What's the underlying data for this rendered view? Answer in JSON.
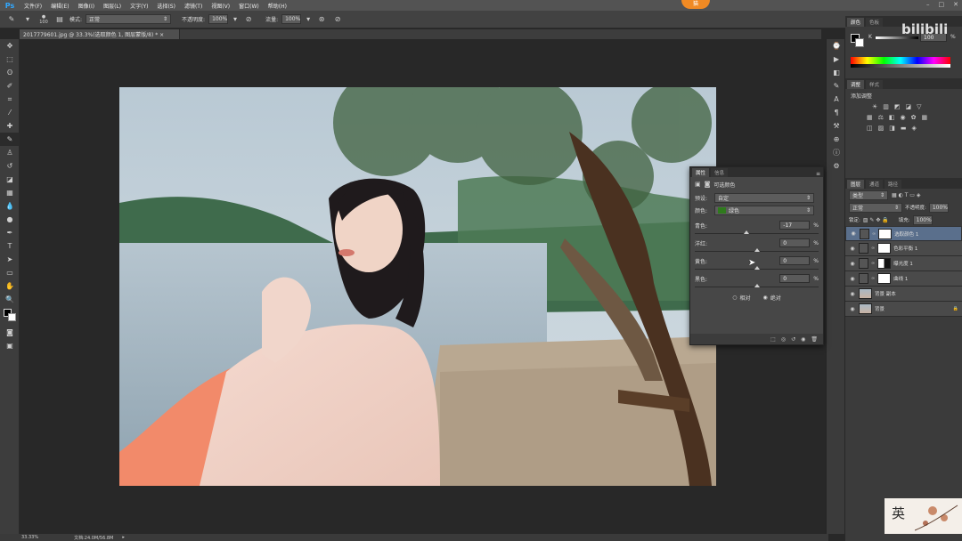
{
  "menubar": {
    "logo": "Ps",
    "items": [
      "文件(F)",
      "编辑(E)",
      "图像(I)",
      "图层(L)",
      "文字(Y)",
      "选择(S)",
      "滤镜(T)",
      "视图(V)",
      "窗口(W)",
      "帮助(H)"
    ],
    "badge": "猫"
  },
  "options": {
    "brush_size": "100",
    "mode_label": "模式:",
    "mode_value": "正常",
    "opacity_label": "不透明度:",
    "opacity_value": "100%",
    "flow_label": "流量:",
    "flow_value": "100%"
  },
  "document": {
    "tab_title": "2017779601.jpg @ 33.3%(选取颜色 1, 图层蒙版/8) * ×"
  },
  "status": {
    "zoom": "33.33%",
    "doc_size": "文档:24.0M/56.8M"
  },
  "color_panel": {
    "tabs": [
      "颜色",
      "色板"
    ],
    "k_label": "K",
    "k_value": "100",
    "percent": "%"
  },
  "adjust_panel": {
    "tabs": [
      "调整",
      "样式"
    ],
    "add_label": "添加调整"
  },
  "layers_panel": {
    "tabs": [
      "图层",
      "通道",
      "路径"
    ],
    "filter_value": "类型",
    "blend_value": "正常",
    "opacity_label": "不透明度:",
    "opacity_value": "100%",
    "lock_label": "锁定:",
    "fill_label": "填充:",
    "fill_value": "100%",
    "layers": [
      {
        "name": "选取颜色 1",
        "selected": true,
        "thumb": "white"
      },
      {
        "name": "色彩平衡 1",
        "selected": false,
        "thumb": "white"
      },
      {
        "name": "曝光度 1",
        "selected": false,
        "thumb": "mask"
      },
      {
        "name": "曲线 1",
        "selected": false,
        "thumb": "white"
      },
      {
        "name": "背景 副本",
        "selected": false,
        "thumb": "photo"
      },
      {
        "name": "背景",
        "selected": false,
        "thumb": "photo"
      }
    ]
  },
  "properties_panel": {
    "tabs": [
      "属性",
      "信息"
    ],
    "title": "可选颜色",
    "preset_label": "预设:",
    "preset_value": "自定",
    "colors_label": "颜色:",
    "colors_value": "绿色",
    "colors_swatch": "#2f7a1d",
    "sliders": [
      {
        "label": "青色:",
        "value": "-17",
        "level": -0.17
      },
      {
        "label": "洋红:",
        "value": "0",
        "level": 0
      },
      {
        "label": "黄色:",
        "value": "0",
        "level": 0
      },
      {
        "label": "黑色:",
        "value": "0",
        "level": 0
      }
    ],
    "unit": "%",
    "mode_relative": "相对",
    "mode_absolute": "绝对",
    "mode_selected": "absolute"
  },
  "watermark": {
    "site": "bilibili",
    "char": "英"
  },
  "colors": {
    "accent_orange": "#f08a24",
    "selected_layer": "#5a6f8c",
    "ps_blue": "#31a8ff"
  }
}
